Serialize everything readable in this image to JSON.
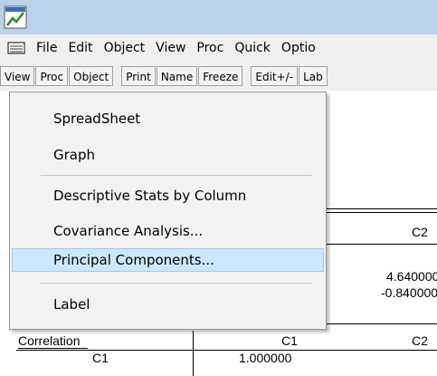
{
  "menubar": {
    "items": [
      "File",
      "Edit",
      "Object",
      "View",
      "Proc",
      "Quick",
      "Optio"
    ]
  },
  "toolbar": {
    "group1": [
      "View",
      "Proc",
      "Object"
    ],
    "group2": [
      "Print",
      "Name",
      "Freeze"
    ],
    "group3": [
      "Edit+/-",
      "Lab"
    ]
  },
  "popup": {
    "items": [
      {
        "label": "SpreadSheet"
      },
      {
        "label": "Graph"
      },
      {
        "label": "Descriptive Stats by Column"
      },
      {
        "label": "Covariance Analysis..."
      },
      {
        "label": "Principal Components..."
      },
      {
        "label": "Label"
      }
    ]
  },
  "sheet": {
    "header_c2_top": "C2",
    "val1": "4.640000",
    "val2": "-0.840000",
    "corr_label": "Correlation",
    "corr_col1": "C1",
    "corr_col2": "C2",
    "row_label": "C1",
    "row_val": "1.000000"
  },
  "colors": {
    "titlebar": "#b9d1ea",
    "highlight": "#cce8ff"
  }
}
